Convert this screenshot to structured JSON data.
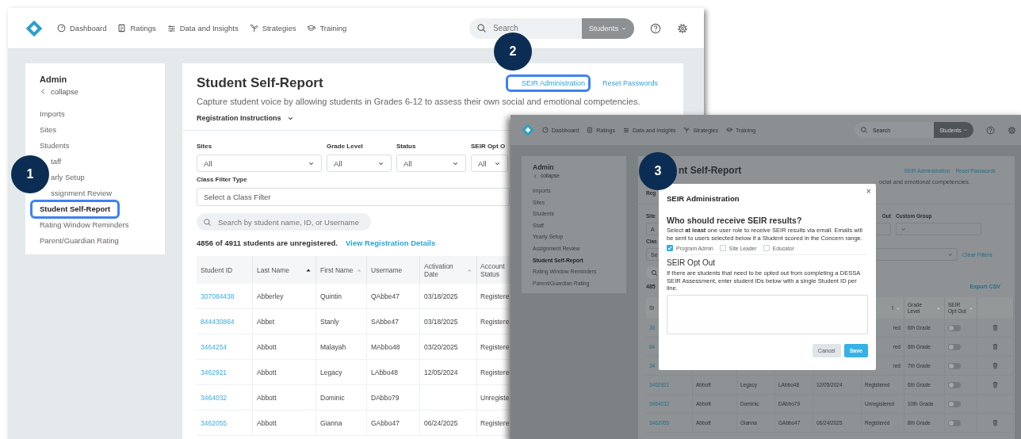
{
  "annotations": [
    {
      "label": "1"
    },
    {
      "label": "2"
    },
    {
      "label": "3"
    }
  ],
  "main_screen": {
    "nav": {
      "items": [
        "Dashboard",
        "Ratings",
        "Data and Insights",
        "Strategies",
        "Training"
      ],
      "search_placeholder": "Search",
      "scope": "Students"
    },
    "sidebar": {
      "title": "Admin",
      "collapse": "collapse",
      "items": [
        {
          "label": "Imports",
          "selected": false,
          "highlighted": false,
          "kind": "full"
        },
        {
          "label": "Sites",
          "selected": false,
          "highlighted": false,
          "kind": "full"
        },
        {
          "label": "Students",
          "selected": false,
          "highlighted": false,
          "kind": "full"
        },
        {
          "label": "taff",
          "selected": false,
          "highlighted": false,
          "kind": "cut"
        },
        {
          "label": "arly Setup",
          "selected": false,
          "highlighted": false,
          "kind": "cut"
        },
        {
          "label": "ssignment Review",
          "selected": false,
          "highlighted": false,
          "kind": "cut"
        },
        {
          "label": "Student Self-Report",
          "selected": true,
          "highlighted": true,
          "kind": "full"
        },
        {
          "label": "Rating Window Reminders",
          "selected": false,
          "highlighted": false,
          "kind": "full"
        },
        {
          "label": "Parent/Guardian Rating",
          "selected": false,
          "highlighted": false,
          "kind": "full"
        }
      ]
    },
    "page": {
      "title": "Student Self-Report",
      "links": [
        {
          "label": "SEIR Administration",
          "highlighted": true
        },
        {
          "label": "Reset Passwords",
          "highlighted": false
        }
      ],
      "description": "Capture student voice by allowing students in Grades 6-12 to assess their own social and emotional competencies.",
      "instructions": "Registration Instructions"
    },
    "filters": [
      {
        "label": "Sites",
        "value": "All"
      },
      {
        "label": "Grade Level",
        "value": "All"
      },
      {
        "label": "Status",
        "value": "All"
      },
      {
        "label": "SEIR Opt O",
        "value": "All"
      }
    ],
    "class_filter": {
      "label": "Class Filter Type",
      "placeholder": "Select a Class Filter"
    },
    "student_search": {
      "placeholder": "Search by student name, ID, or Username"
    },
    "summary": {
      "text": "4856 of 4911 students are unregistered.",
      "link": "View Registration Details"
    },
    "table": {
      "columns": [
        {
          "label": "Student ID",
          "sortable": false,
          "sorted": false
        },
        {
          "label": "Last Name",
          "sortable": true,
          "sorted": true
        },
        {
          "label": "First Name",
          "sortable": true,
          "sorted": false
        },
        {
          "label": "Username",
          "sortable": false,
          "sorted": false
        },
        {
          "label": "Activation Date",
          "sortable": true,
          "sorted": false
        },
        {
          "label": "Account Status",
          "sortable": false,
          "sorted": false
        }
      ],
      "rows": [
        {
          "student_id": "307084438",
          "last_name": "Abberley",
          "first_name": "Quintin",
          "username": "QAbbe47",
          "activation_date": "03/18/2025",
          "account_status": "Registere"
        },
        {
          "student_id": "844430864",
          "last_name": "Abbet",
          "first_name": "Stanly",
          "username": "SAbbe47",
          "activation_date": "03/18/2025",
          "account_status": "Registere"
        },
        {
          "student_id": "3464254",
          "last_name": "Abbott",
          "first_name": "Malayah",
          "username": "MAbbo48",
          "activation_date": "03/20/2025",
          "account_status": "Registere"
        },
        {
          "student_id": "3462921",
          "last_name": "Abbott",
          "first_name": "Legacy",
          "username": "LAbbo48",
          "activation_date": "12/05/2024",
          "account_status": "Registere"
        },
        {
          "student_id": "3464032",
          "last_name": "Abbott",
          "first_name": "Dominic",
          "username": "DAbbo79",
          "account_status": "Unregiste"
        },
        {
          "student_id": "3462055",
          "last_name": "Abbott",
          "first_name": "Gianna",
          "username": "GAbbo47",
          "activation_date": "06/24/2025",
          "account_status": "Registere"
        }
      ]
    }
  },
  "dialog_screen": {
    "nav": {
      "items": [
        "Dashboard",
        "Ratings",
        "Data and Insights",
        "Strategies",
        "Training"
      ],
      "search_placeholder": "Search",
      "scope": "Students"
    },
    "sidebar": {
      "title": "Admin",
      "collapse": "collapse",
      "items": [
        {
          "label": "Imports",
          "selected": false
        },
        {
          "label": "Sites",
          "selected": false
        },
        {
          "label": "Students",
          "selected": false
        },
        {
          "label": "Staff",
          "selected": false
        },
        {
          "label": "Yearly Setup",
          "selected": false
        },
        {
          "label": "Assignment Review",
          "selected": false
        },
        {
          "label": "Student Self-Report",
          "selected": true
        },
        {
          "label": "Rating Window Reminders",
          "selected": false
        },
        {
          "label": "Parent/Guardian Rating",
          "selected": false
        }
      ]
    },
    "page": {
      "title": "nt Self-Report",
      "links": [
        "SEIR Administration",
        "Reset Passwords"
      ],
      "description": "ocial and emotional competencies.",
      "instructions": "Reg"
    },
    "filters": [
      {
        "label": "Site",
        "value": "A"
      },
      {
        "label": "Out"
      },
      {
        "label": "Custom Group"
      }
    ],
    "class_filter": {
      "label": "Clas",
      "placeholder": "Se",
      "clear": "Clear Filters"
    },
    "count": "485",
    "export": "Export CSV",
    "table": {
      "columns": [
        {
          "label": "St"
        },
        {
          "label": "t",
          "sortable": true
        },
        {
          "label": "Grade Level",
          "sortable": true
        },
        {
          "label": "SEIR Opt Out",
          "sortable": true
        }
      ],
      "rows": [
        {
          "kind": "behind-dialog",
          "student_id": "30",
          "account_status": "red",
          "grade_level": "6th Grade",
          "opt_out": false,
          "deletable": true
        },
        {
          "kind": "behind-dialog",
          "student_id": "84",
          "account_status": "red",
          "grade_level": "6th Grade",
          "opt_out": false,
          "deletable": true
        },
        {
          "kind": "behind-dialog",
          "student_id": "34",
          "account_status": "red",
          "grade_level": "7th Grade",
          "opt_out": false,
          "deletable": true
        },
        {
          "kind": "full",
          "student_id": "3462921",
          "last_name": "Abbott",
          "first_name": "Legacy",
          "username": "LAbbo48",
          "activation_date": "12/05/2024",
          "account_status": "Registered",
          "grade_level": "6th Grade",
          "opt_out": false,
          "deletable": true
        },
        {
          "kind": "full",
          "student_id": "3464032",
          "last_name": "Abbott",
          "first_name": "Dominic",
          "username": "DAbbo79",
          "account_status": "Unregistered",
          "grade_level": "10th Grade",
          "opt_out": false,
          "deletable": false
        },
        {
          "kind": "full",
          "student_id": "3462055",
          "last_name": "Abbott",
          "first_name": "Gianna",
          "username": "GAbbo47",
          "activation_date": "06/24/2025",
          "account_status": "Registered",
          "grade_level": "8th Grade",
          "opt_out": false,
          "deletable": true
        }
      ]
    },
    "dialog": {
      "title": "SEIR Administration",
      "close": "×",
      "heading": "Who should receive SEIR results?",
      "description": "Select **at least** one user role to receive SEIR results via email. Emails will be sent to users selected below if a Student scored in the Concern range.",
      "roles": [
        {
          "label": "Program Admin",
          "checked": true
        },
        {
          "label": "Site Leader",
          "checked": false
        },
        {
          "label": "Educator",
          "checked": false
        }
      ],
      "opt_out_heading": "SEIR Opt Out",
      "opt_out_description": "If there are students that need to be opted out from completing a DESSA SEIR Assessment, enter student IDs below with a single Student ID per line.",
      "buttons": [
        {
          "label": "Cancel",
          "kind": "secondary"
        },
        {
          "label": "Save",
          "kind": "primary"
        }
      ]
    }
  }
}
